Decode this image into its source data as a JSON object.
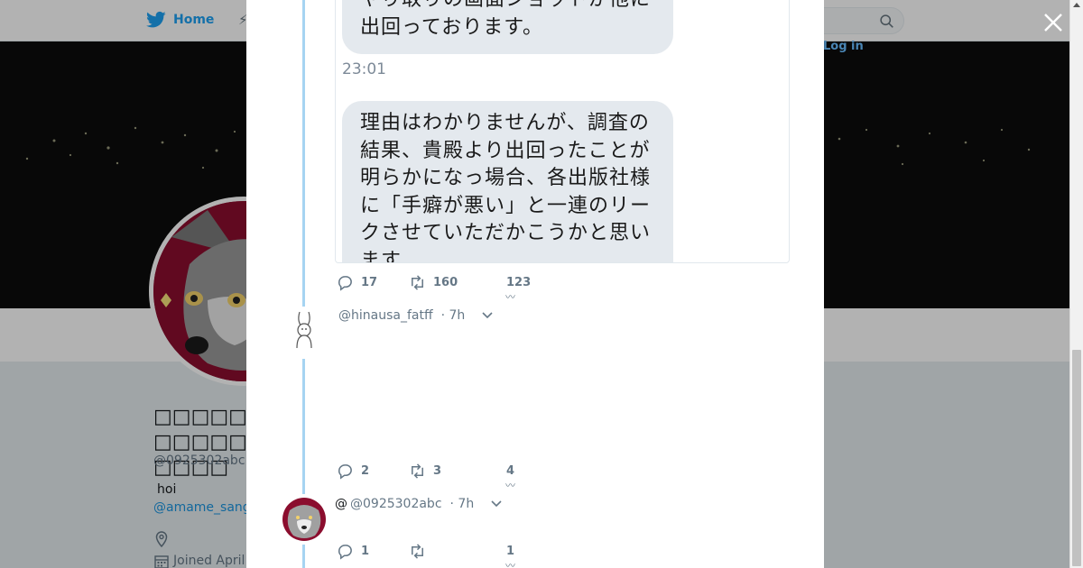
{
  "nav": {
    "home_label": "Home",
    "login_label": "Log in"
  },
  "profile": {
    "name": "□□□□□□□□□□□□□□",
    "handle": "@0925302abc",
    "bio": "hoi",
    "mention": "@amame_sang",
    "joined": "Joined April"
  },
  "tweet": {
    "bubble_top": "やり取りの画面ショットが他に出回っております。",
    "time": "23:01",
    "bubble_main": "理由はわかりませんが、調査の結果、貴殿より出回ったことが明らかになっ場合、各出版社様に「手癖が悪い」と一連のリークさせていただかこうかと思います",
    "replies": "17",
    "retweets": "160",
    "likes": "123"
  },
  "reply1": {
    "handle": "@hinausa_fatff",
    "time": "· 7h",
    "replies": "2",
    "retweets": "3",
    "likes": "4"
  },
  "reply2": {
    "prefix": "@",
    "handle": "@0925302abc",
    "time": "· 7h",
    "replies": "1",
    "retweets": "",
    "likes": "1"
  },
  "colors": {
    "accent": "#1da1f2",
    "thread_line": "#a6d4f2",
    "avatar_bg": "#8b0d2e"
  }
}
